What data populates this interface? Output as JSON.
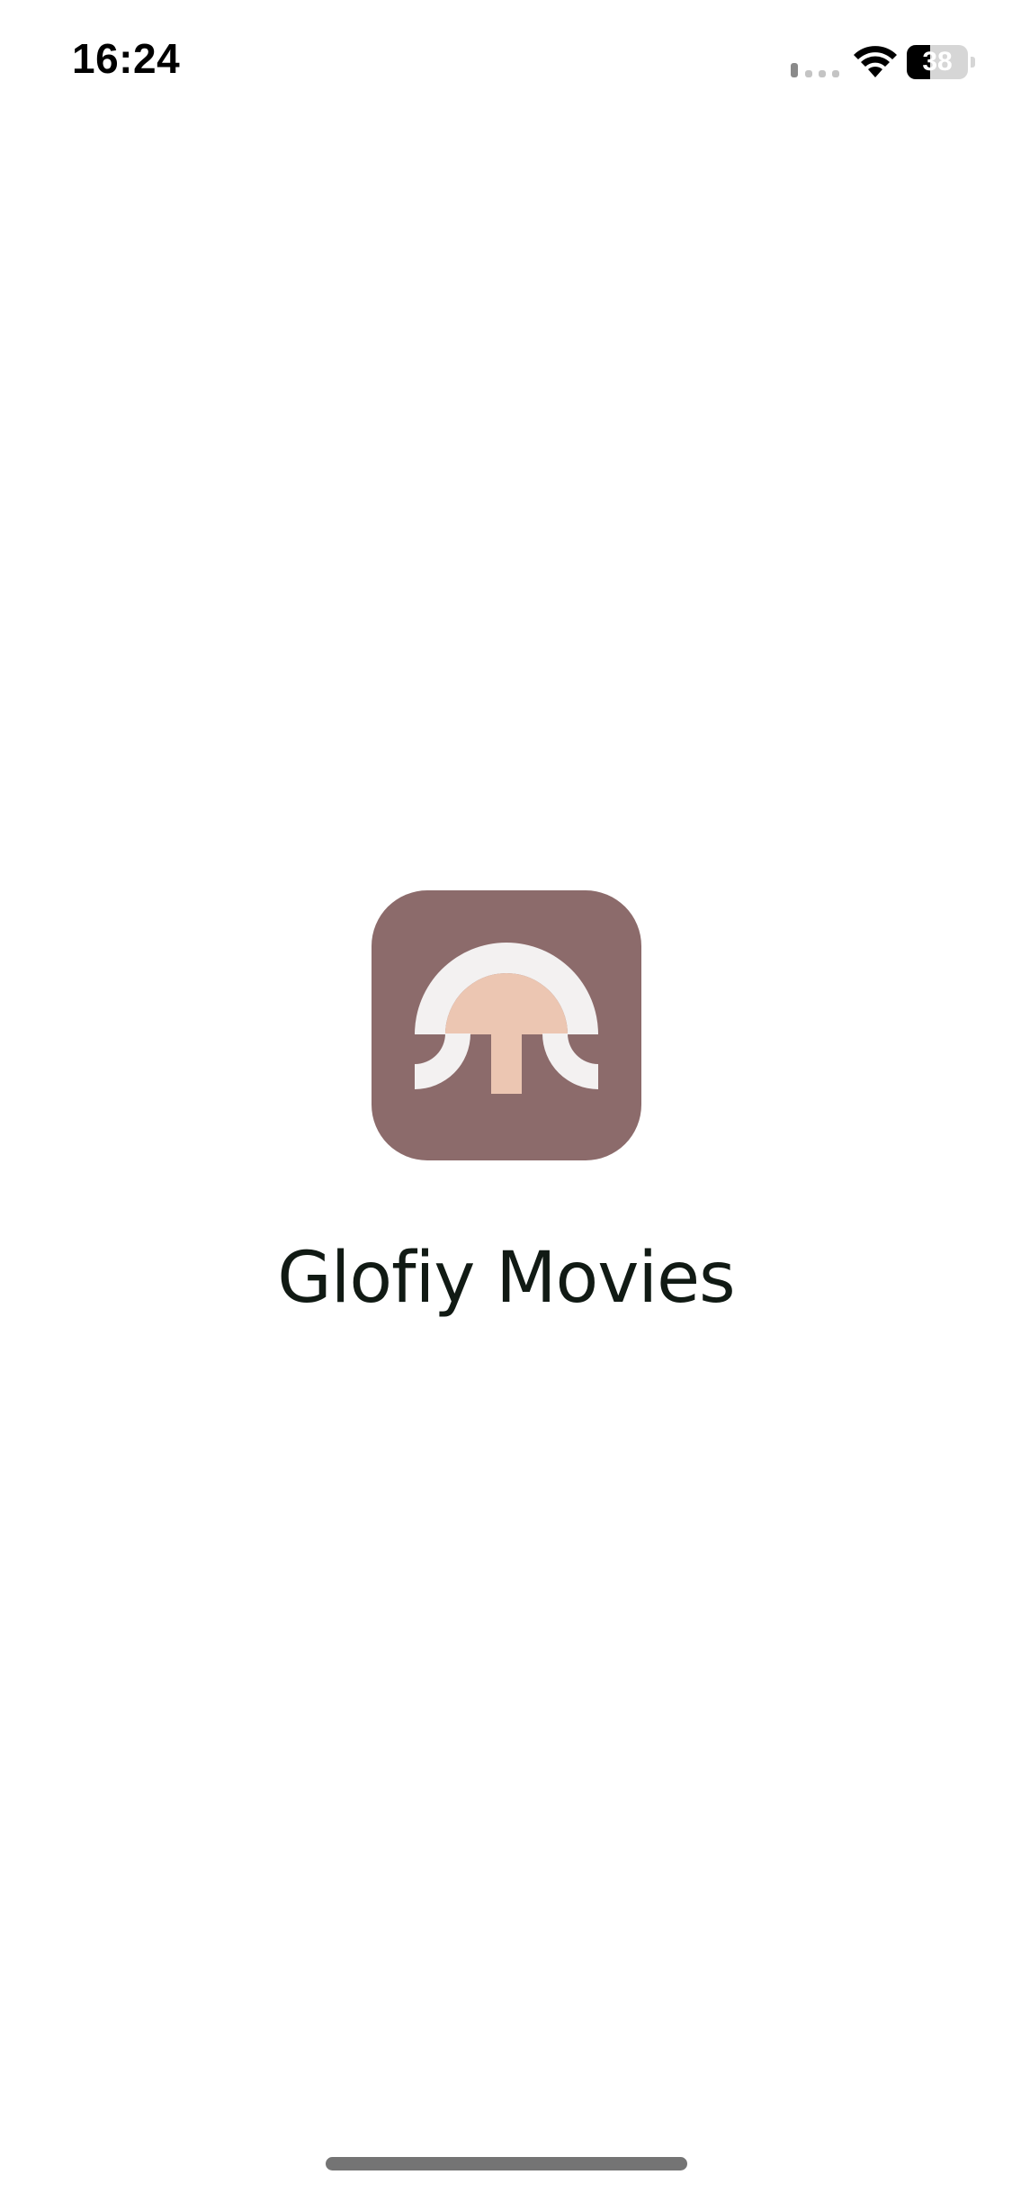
{
  "status_bar": {
    "time": "16:24",
    "battery_level": "38",
    "battery_fraction": 0.38,
    "icons": [
      "cellular-signal-icon",
      "wifi-icon",
      "battery-icon"
    ]
  },
  "splash": {
    "app_name": "Glofiy Movies",
    "logo_icon": "mushroom-logo-icon"
  },
  "colors": {
    "logo_background": "#8c6b6b",
    "logo_arch": "#f3f1f1",
    "logo_cap": "#ecc6b2",
    "title_text": "#111a14",
    "page_background": "#ffffff"
  }
}
